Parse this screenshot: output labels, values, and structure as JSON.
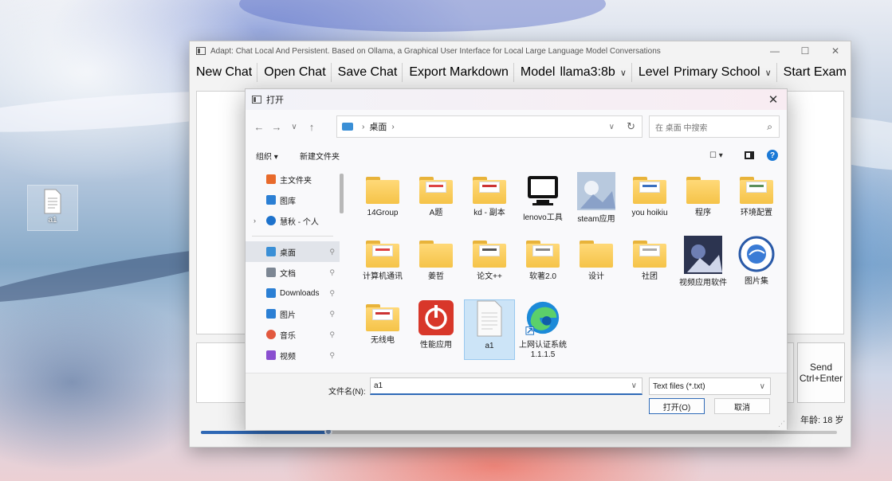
{
  "desktop": {
    "icon_label": "a1"
  },
  "app": {
    "title": "Adapt: Chat Local And Persistent. Based on Ollama, a Graphical User Interface for Local Large Language Model Conversations",
    "window_controls": [
      "—",
      "☐",
      "✕"
    ],
    "toolbar": {
      "new_chat": "New Chat",
      "open_chat": "Open Chat",
      "save_chat": "Save Chat",
      "export_markdown": "Export Markdown",
      "model_label": "Model",
      "model_value": "llama3:8b",
      "level_label": "Level",
      "level_value": "Primary School",
      "start_exam": "Start Exam"
    },
    "send_line1": "Send",
    "send_line2": "Ctrl+Enter",
    "age_label": "年龄: 18 岁",
    "age_slider_fraction": 0.2
  },
  "dialog": {
    "title": "打开",
    "close": "✕",
    "nav": {
      "back": "←",
      "forward": "→",
      "recent": "∨",
      "up": "↑"
    },
    "address": {
      "sep": "›",
      "path": "桌面",
      "sep2": "›",
      "refresh": "↻",
      "dropdown": "∨"
    },
    "search_placeholder": "在 桌面 中搜索",
    "search_icon": "⌕",
    "commands": {
      "organize": "组织 ▾",
      "new_folder": "新建文件夹",
      "view": "☐ ▾"
    },
    "sidebar": [
      {
        "label": "主文件夹",
        "icon": "home-icon",
        "color": "#e86a2b"
      },
      {
        "label": "图库",
        "icon": "gallery-icon",
        "color": "#2b7fd4"
      },
      {
        "label": "慧秋 - 个人",
        "icon": "cloud-icon",
        "color": "#1d72cc",
        "expander": "›"
      },
      {
        "label": "桌面",
        "icon": "desktop-icon",
        "color": "#3a8fd6",
        "pin": "📌"
      },
      {
        "label": "文档",
        "icon": "document-icon",
        "color": "#7d8794",
        "pin": "📌"
      },
      {
        "label": "Downloads",
        "icon": "download-icon",
        "color": "#2b7fd4",
        "pin": "📌"
      },
      {
        "label": "图片",
        "icon": "pictures-icon",
        "color": "#2b7fd4",
        "pin": "📌"
      },
      {
        "label": "音乐",
        "icon": "music-icon",
        "color": "#e2583e",
        "pin": "📌"
      },
      {
        "label": "视频",
        "icon": "video-icon",
        "color": "#8a4fd0",
        "pin": "📌"
      }
    ],
    "files": [
      {
        "name": "14Group",
        "kind": "folder"
      },
      {
        "name": "A题",
        "kind": "folder"
      },
      {
        "name": "kd - 副本",
        "kind": "folder"
      },
      {
        "name": "lenovo工具",
        "kind": "app"
      },
      {
        "name": "steam应用",
        "kind": "image"
      },
      {
        "name": "you hoikiu",
        "kind": "folder"
      },
      {
        "name": "程序",
        "kind": "folder"
      },
      {
        "name": "环境配置",
        "kind": "folder"
      },
      {
        "name": "计算机通讯",
        "kind": "folder"
      },
      {
        "name": "姜哲",
        "kind": "folder"
      },
      {
        "name": "论文++",
        "kind": "folder"
      },
      {
        "name": "软著2.0",
        "kind": "folder"
      },
      {
        "name": "设计",
        "kind": "folder"
      },
      {
        "name": "社团",
        "kind": "folder"
      },
      {
        "name": "视频应用软件",
        "kind": "image"
      },
      {
        "name": "图片集",
        "kind": "logo"
      },
      {
        "name": "无线电",
        "kind": "folder"
      },
      {
        "name": "性能应用",
        "kind": "power"
      },
      {
        "name": "a1",
        "kind": "file"
      },
      {
        "name": "上网认证系统1.1.1.5",
        "kind": "edge"
      }
    ],
    "filename_label": "文件名(N):",
    "filename_value": "a1",
    "filetype_value": "Text files (*.txt)",
    "open_button": "打开(O)",
    "cancel_button": "取消"
  },
  "colors": {
    "accent": "#2f68b5",
    "folder": "#f5c348",
    "selection": "#cce4f7"
  }
}
